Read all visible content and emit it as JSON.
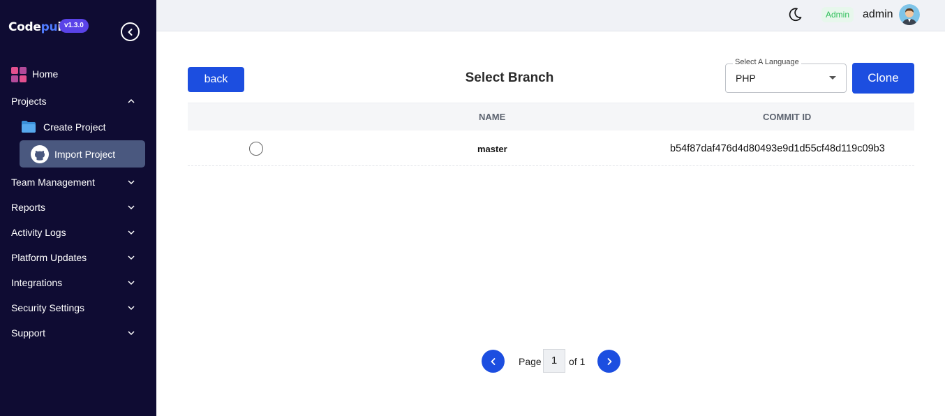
{
  "app": {
    "brand_prefix": "Code",
    "brand_accent": "pu",
    "brand_suffix": "i",
    "version": "v1.3.0",
    "accent_color": "#1c4ee0"
  },
  "sidebar": {
    "collapse_icon": "chevron-left-icon",
    "home_label": "Home",
    "projects_label": "Projects",
    "sub_items": [
      {
        "label": "Create Project",
        "icon": "folder-icon"
      },
      {
        "label": "Import Project",
        "icon": "github-icon",
        "active": true
      }
    ],
    "items": [
      {
        "label": "Team Management"
      },
      {
        "label": "Reports"
      },
      {
        "label": "Activity Logs"
      },
      {
        "label": "Platform Updates"
      },
      {
        "label": "Integrations"
      },
      {
        "label": "Security Settings"
      },
      {
        "label": "Support"
      }
    ]
  },
  "topbar": {
    "theme_icon": "moon-icon",
    "role_badge": "Admin",
    "username": "admin"
  },
  "main": {
    "back_label": "back",
    "heading": "Select Branch",
    "language_select": {
      "legend": "Select A Language",
      "value": "PHP"
    },
    "clone_label": "Clone",
    "table": {
      "columns": [
        "NAME",
        "COMMIT ID"
      ],
      "rows": [
        {
          "name": "master",
          "commit_id": "b54f87daf476d4d80493e9d1d55cf48d119c09b3"
        }
      ]
    },
    "pagination": {
      "page_label": "Page",
      "current": "1",
      "of_label": "of 1"
    }
  }
}
